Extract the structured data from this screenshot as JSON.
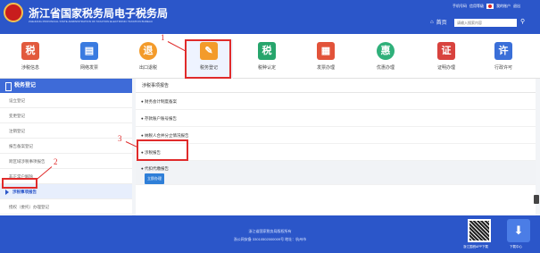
{
  "header": {
    "title": "浙江省国家税务局电子税务局",
    "subtitle": "ZHEJIANG PROVINCIAL STATE ADMINISTRATION OF TAXATION ELECTRONIC TAXATION BUREAU",
    "top_links": [
      "手机号码",
      "信用等级",
      "我的账户",
      "退出"
    ],
    "home_label": "首页",
    "search_placeholder": "请输入搜索内容"
  },
  "nav": {
    "items": [
      {
        "label": "涉税信息",
        "icon": "tax-info-icon",
        "color": "#e25a3d",
        "glyph": "税"
      },
      {
        "label": "网络发票",
        "icon": "printer-icon",
        "color": "#3a7be0",
        "glyph": "▤"
      },
      {
        "label": "出口退税",
        "icon": "export-refund-icon",
        "color": "#f39b2b",
        "glyph": "退"
      },
      {
        "label": "税务登记",
        "icon": "registration-icon",
        "color": "#f39b2b",
        "glyph": "✎"
      },
      {
        "label": "税种认定",
        "icon": "tax-type-icon",
        "color": "#27a56c",
        "glyph": "税"
      },
      {
        "label": "发票办理",
        "icon": "invoice-icon",
        "color": "#e2533a",
        "glyph": "▦"
      },
      {
        "label": "优惠办理",
        "icon": "discount-icon",
        "color": "#2fb07a",
        "glyph": "惠"
      },
      {
        "label": "证明办理",
        "icon": "certificate-icon",
        "color": "#d8433e",
        "glyph": "证"
      },
      {
        "label": "行政许可",
        "icon": "license-icon",
        "color": "#3a6fd8",
        "glyph": "许"
      }
    ]
  },
  "sidebar": {
    "title": "税务登记",
    "items": [
      {
        "label": "设立登记"
      },
      {
        "label": "变更登记"
      },
      {
        "label": "注销登记"
      },
      {
        "label": "报告备案登记"
      },
      {
        "label": "跨区域涉税事项报告"
      },
      {
        "label": "非正常户解除"
      },
      {
        "label": "涉税事项报告"
      },
      {
        "label": "授权（委托）办理登记"
      }
    ]
  },
  "main": {
    "tab_title": "涉税事项报告",
    "rows": [
      {
        "label": "● 财务会计制度备案"
      },
      {
        "label": "● 存款账户账号报告"
      },
      {
        "label": "● 纳税人合并分立情况报告"
      },
      {
        "label": "● 涉税报告"
      },
      {
        "label": "● 代扣代缴报告",
        "badge": "立即办理"
      }
    ]
  },
  "annotations": {
    "one": "1",
    "two": "2",
    "three": "3"
  },
  "footer": {
    "line1": "浙江省国家税务局版权所有",
    "line2": "浙公网安备 33010502000009号  地址：杭州市",
    "qr_label": "浙江国税APP下载",
    "app_label": "下载中心"
  }
}
